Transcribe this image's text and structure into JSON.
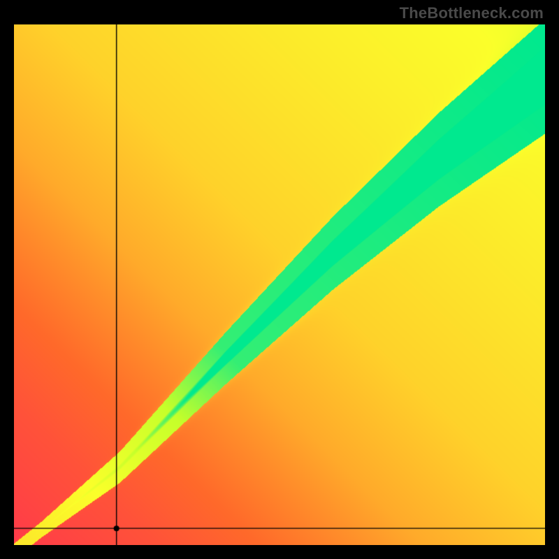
{
  "watermark": "TheBottleneck.com",
  "chart_data": {
    "type": "heatmap",
    "title": "",
    "xlabel": "",
    "ylabel": "",
    "xlim": [
      0,
      1
    ],
    "ylim": [
      0,
      1
    ],
    "axes_visible": false,
    "grid": false,
    "colormap_stops": [
      {
        "t": 0.0,
        "color": "#ff2a55"
      },
      {
        "t": 0.25,
        "color": "#ff6a2a"
      },
      {
        "t": 0.5,
        "color": "#ffd22a"
      },
      {
        "t": 0.72,
        "color": "#fbff2a"
      },
      {
        "t": 0.86,
        "color": "#c6ff2a"
      },
      {
        "t": 1.0,
        "color": "#00e98f"
      }
    ],
    "optimal_band": {
      "description": "Green optimal-ratio band along the diagonal; value is highest near this band and falls off with distance and toward the lower-left.",
      "center_line": [
        {
          "x": 0.04,
          "y": 0.02
        },
        {
          "x": 0.2,
          "y": 0.15
        },
        {
          "x": 0.4,
          "y": 0.36
        },
        {
          "x": 0.6,
          "y": 0.56
        },
        {
          "x": 0.8,
          "y": 0.74
        },
        {
          "x": 1.0,
          "y": 0.9
        }
      ],
      "half_width_at": [
        {
          "x": 0.05,
          "w": 0.015
        },
        {
          "x": 0.25,
          "w": 0.035
        },
        {
          "x": 0.5,
          "w": 0.06
        },
        {
          "x": 0.75,
          "w": 0.085
        },
        {
          "x": 1.0,
          "w": 0.11
        }
      ]
    },
    "crosshair": {
      "x": 0.193,
      "y": 0.032,
      "marker_radius_px": 4
    },
    "field_model": {
      "radial_gain_center": {
        "x": 1.0,
        "y": 1.0
      },
      "radial_gain_exponent": 0.65,
      "band_sigma_scale": 0.42
    }
  }
}
